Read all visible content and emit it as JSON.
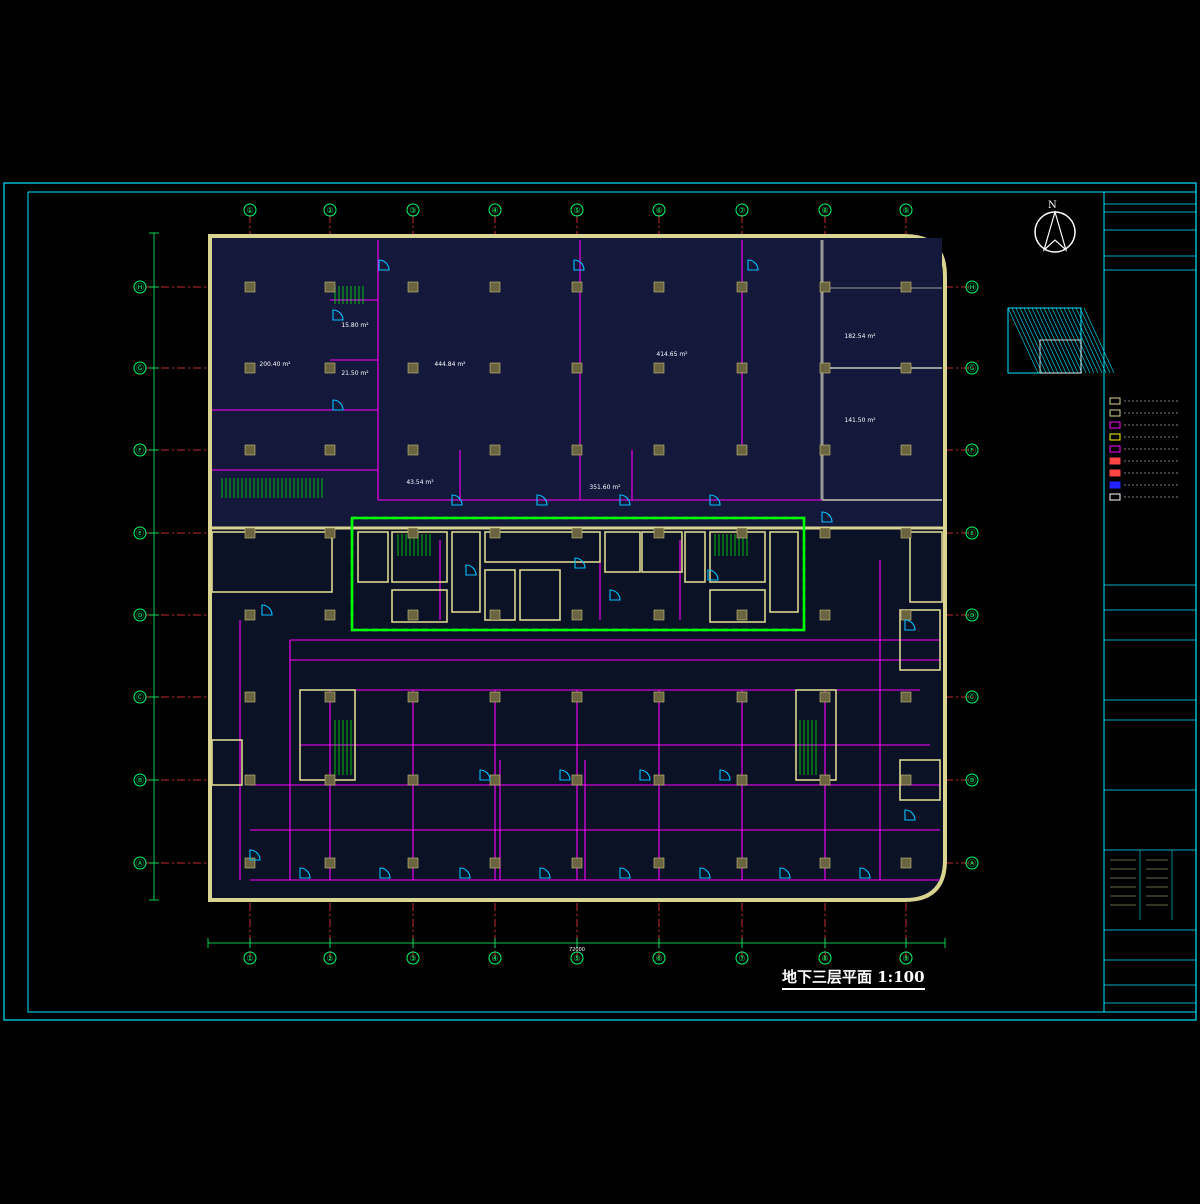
{
  "drawing": {
    "title": "地下三层平面 1:100",
    "north_label": "N"
  },
  "colors": {
    "frame": "#00e5ff",
    "wall": "#d9d48f",
    "partition": "#ff00ff",
    "door": "#00bfff",
    "axis": "#ff3b3b",
    "evac_zone": "#00ff00",
    "dim": "#00ff66",
    "column": "#c8c07a",
    "bg": "#000000"
  },
  "axes": {
    "vertical": [
      "①",
      "②",
      "③",
      "④",
      "⑤",
      "⑥",
      "⑦",
      "⑧",
      "⑨"
    ],
    "horizontal": [
      "Ⓗ",
      "Ⓖ",
      "Ⓕ",
      "Ⓔ",
      "Ⓓ",
      "Ⓒ",
      "Ⓑ",
      "Ⓐ"
    ]
  },
  "areas": [
    "200.40 m²",
    "444.84 m²",
    "414.65 m²",
    "15.80 m²",
    "21.50 m²",
    "182.54 m²",
    "141.50 m²",
    "43.54 m²",
    "351.60 m²"
  ],
  "total_dim": "72000",
  "legend_rows": 9
}
